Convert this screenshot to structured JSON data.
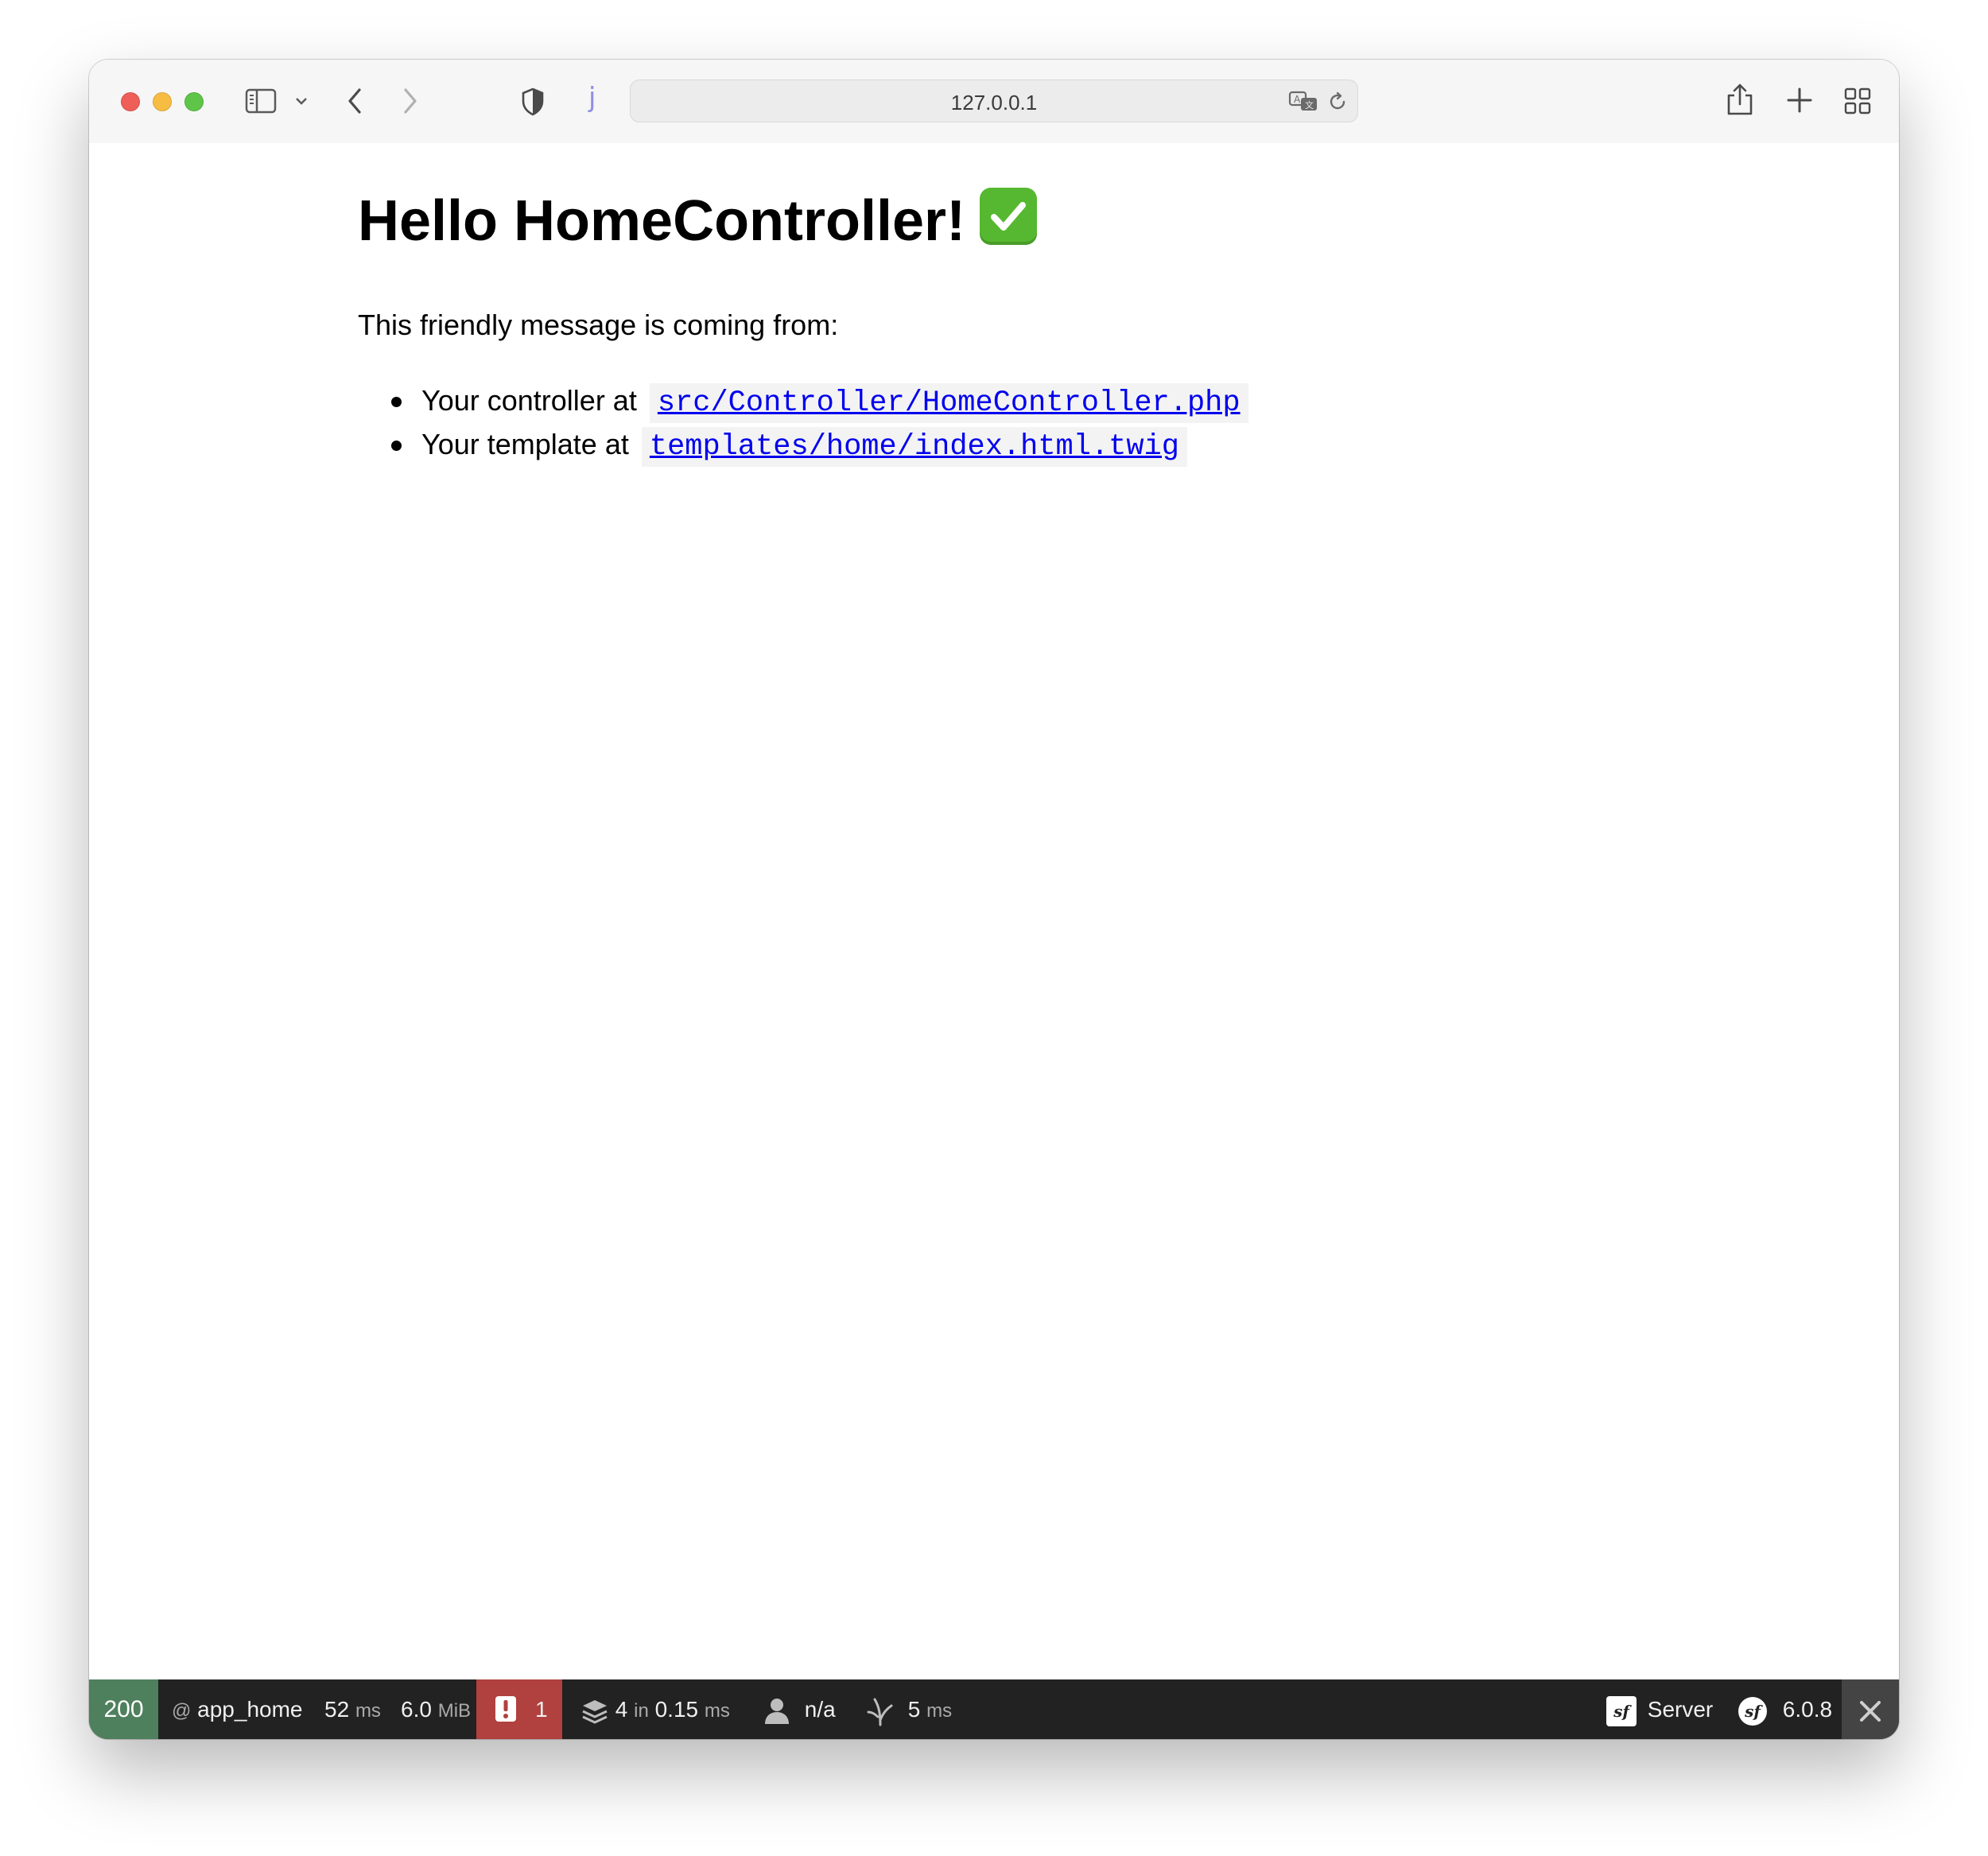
{
  "browser": {
    "address": "127.0.0.1",
    "reader_letter": "j"
  },
  "page": {
    "title": "Hello HomeController!",
    "intro": "This friendly message is coming from:",
    "items": [
      {
        "prefix": "Your controller at",
        "path": "src/Controller/HomeController.php"
      },
      {
        "prefix": "Your template at",
        "path": "templates/home/index.html.twig"
      }
    ]
  },
  "debugbar": {
    "status": "200",
    "route_at": "@",
    "route": "app_home",
    "time_value": "52",
    "time_unit": "ms",
    "memory_value": "6.0",
    "memory_unit": "MiB",
    "errors": "1",
    "cache_count": "4",
    "cache_in": "in",
    "cache_time": "0.15",
    "cache_unit": "ms",
    "user": "n/a",
    "twig_time": "5",
    "twig_unit": "ms",
    "server_label": "Server",
    "version": "6.0.8",
    "sf_glyph": "sf"
  },
  "colors": {
    "status_ok": "#4f805d",
    "error_bg": "#b0413e",
    "link": "#0000ee",
    "debugbar_bg": "#222222"
  }
}
